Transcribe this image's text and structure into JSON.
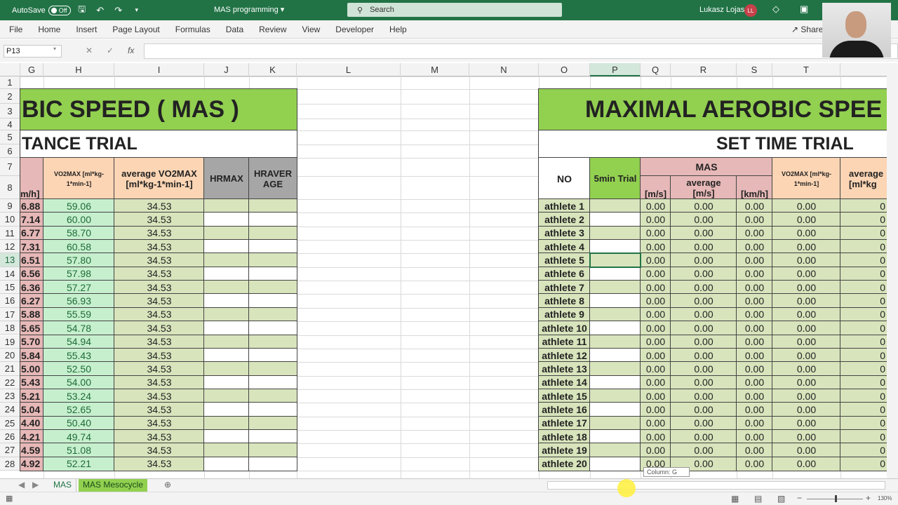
{
  "titlebar": {
    "autosave_label": "AutoSave",
    "autosave_state": "Off",
    "doc_title": "MAS programming",
    "search_placeholder": "Search",
    "user_name": "Lukasz Lojas",
    "user_initials": "LL"
  },
  "ribbon": {
    "tabs": [
      "File",
      "Home",
      "Insert",
      "Page Layout",
      "Formulas",
      "Data",
      "Review",
      "View",
      "Developer",
      "Help"
    ],
    "share_label": "Share"
  },
  "formula_bar": {
    "name_box": "P13",
    "fx_label": "fx",
    "value": ""
  },
  "columns": [
    "G",
    "H",
    "I",
    "J",
    "K",
    "L",
    "M",
    "N",
    "O",
    "P",
    "Q",
    "R",
    "S",
    "T"
  ],
  "selected_column": "P",
  "selected_row": 13,
  "rows": [
    1,
    2,
    3,
    4,
    5,
    6,
    7,
    8,
    9,
    10,
    11,
    12,
    13,
    14,
    15,
    16,
    17,
    18,
    19,
    20,
    21,
    22,
    23,
    24,
    25,
    26,
    27,
    28
  ],
  "left_table": {
    "title": "BIC SPEED ( MAS )",
    "subtitle": "TANCE TRIAL",
    "headers": {
      "g": "m/h]",
      "h": "VO2MAX [ml*kg-1*min-1]",
      "i_line1": "average VO2MAX",
      "i_line2": "[ml*kg-1*min-1]",
      "j": "HRMAX",
      "k_line1": "HRAVER",
      "k_line2": "AGE"
    },
    "g_values": [
      "6.88",
      "7.14",
      "6.77",
      "7.31",
      "6.51",
      "6.56",
      "6.36",
      "6.27",
      "5.88",
      "5.65",
      "5.70",
      "5.84",
      "5.00",
      "5.43",
      "5.21",
      "5.04",
      "4.40",
      "4.21",
      "4.59",
      "4.92"
    ],
    "h_values": [
      "59.06",
      "60.00",
      "58.70",
      "60.58",
      "57.80",
      "57.98",
      "57.27",
      "56.93",
      "55.59",
      "54.78",
      "54.94",
      "55.43",
      "52.50",
      "54.00",
      "53.24",
      "52.65",
      "50.40",
      "49.74",
      "51.08",
      "52.21"
    ],
    "i_values": [
      "34.53",
      "34.53",
      "34.53",
      "34.53",
      "34.53",
      "34.53",
      "34.53",
      "34.53",
      "34.53",
      "34.53",
      "34.53",
      "34.53",
      "34.53",
      "34.53",
      "34.53",
      "34.53",
      "34.53",
      "34.53",
      "34.53",
      "34.53"
    ]
  },
  "right_table": {
    "title": "MAXIMAL AEROBIC SPEE",
    "subtitle": "SET TIME TRIAL",
    "headers": {
      "no": "NO",
      "trial": "5min Trial",
      "mas": "MAS",
      "q": "[m/s]",
      "r_line1": "average",
      "r_line2": "[m/s]",
      "s": "[km/h]",
      "t": "VO2MAX [ml*kg-1*min-1]",
      "u_line1": "average",
      "u_line2": "[ml*kg"
    },
    "athletes": [
      "athlete 1",
      "athlete 2",
      "athlete 3",
      "athlete 4",
      "athlete 5",
      "athlete 6",
      "athlete 7",
      "athlete 8",
      "athlete 9",
      "athlete 10",
      "athlete 11",
      "athlete 12",
      "athlete 13",
      "athlete 14",
      "athlete 15",
      "athlete 16",
      "athlete 17",
      "athlete 18",
      "athlete 19",
      "athlete 20"
    ],
    "zero_value": "0.00",
    "u_value": "0"
  },
  "sheet_tabs": [
    "MAS",
    "MAS Mesocycle"
  ],
  "tooltip": "Column: G",
  "status": {
    "zoom": "130%"
  },
  "colors": {
    "excel_green": "#217346",
    "header_green": "#92d050",
    "light_green": "#c6efce",
    "pale_green": "#d8e4bc",
    "pink": "#e6b8b7",
    "peach": "#fcd5b4",
    "grey": "#a6a6a6"
  }
}
